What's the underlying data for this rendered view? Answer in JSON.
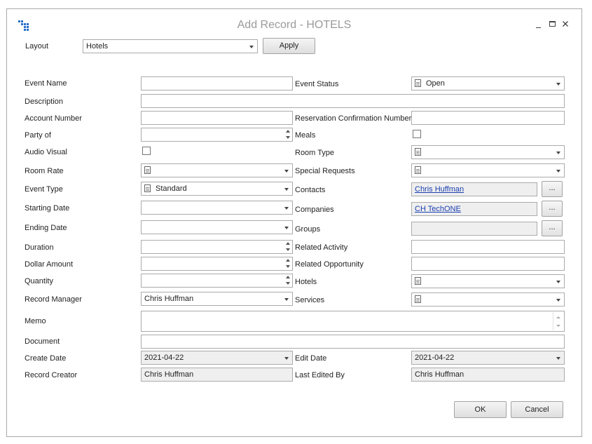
{
  "window": {
    "title": "Add Record - HOTELS",
    "controls": {
      "minimize": "_",
      "maximize": "□",
      "close": "✕"
    }
  },
  "layout": {
    "label": "Layout",
    "value": "Hotels",
    "apply_label": "Apply"
  },
  "fields": {
    "event_name": {
      "label": "Event Name",
      "value": ""
    },
    "event_status": {
      "label": "Event Status",
      "value": "Open"
    },
    "description": {
      "label": "Description",
      "value": ""
    },
    "account_number": {
      "label": "Account Number",
      "value": ""
    },
    "reservation_confirmation_number": {
      "label": "Reservation Confirmation Number",
      "value": ""
    },
    "party_of": {
      "label": "Party of",
      "value": ""
    },
    "meals": {
      "label": "Meals",
      "checked": false
    },
    "audio_visual": {
      "label": "Audio Visual",
      "checked": false
    },
    "room_type": {
      "label": "Room Type",
      "value": ""
    },
    "room_rate": {
      "label": "Room Rate",
      "value": ""
    },
    "special_requests": {
      "label": "Special Requests",
      "value": ""
    },
    "event_type": {
      "label": "Event Type",
      "value": "Standard"
    },
    "contacts": {
      "label": "Contacts",
      "value": "Chris Huffman",
      "button": "..."
    },
    "starting_date": {
      "label": "Starting Date",
      "value": ""
    },
    "companies": {
      "label": "Companies",
      "value": "CH TechONE",
      "button": "..."
    },
    "ending_date": {
      "label": "Ending Date",
      "value": ""
    },
    "groups": {
      "label": "Groups",
      "value": "",
      "button": "..."
    },
    "duration": {
      "label": "Duration",
      "value": ""
    },
    "related_activity": {
      "label": "Related Activity",
      "value": ""
    },
    "dollar_amount": {
      "label": "Dollar Amount",
      "value": ""
    },
    "related_opportunity": {
      "label": "Related Opportunity",
      "value": ""
    },
    "quantity": {
      "label": "Quantity",
      "value": ""
    },
    "hotels": {
      "label": "Hotels",
      "value": ""
    },
    "record_manager": {
      "label": "Record Manager",
      "value": "Chris Huffman"
    },
    "services": {
      "label": "Services",
      "value": ""
    },
    "memo": {
      "label": "Memo",
      "value": ""
    },
    "document": {
      "label": "Document",
      "value": ""
    },
    "create_date": {
      "label": "Create Date",
      "value": "2021-04-22"
    },
    "edit_date": {
      "label": "Edit Date",
      "value": "2021-04-22"
    },
    "record_creator": {
      "label": "Record Creator",
      "value": "Chris Huffman"
    },
    "last_edited_by": {
      "label": "Last Edited By",
      "value": "Chris Huffman"
    }
  },
  "footer": {
    "ok_label": "OK",
    "cancel_label": "Cancel"
  },
  "colors": {
    "link": "#1a3fb0",
    "title": "#9a9a9a",
    "readonly_bg": "#efefef",
    "app_icon": "#2a6fc9"
  },
  "icons": {
    "app": "grid-app-icon",
    "document": "document-icon"
  }
}
